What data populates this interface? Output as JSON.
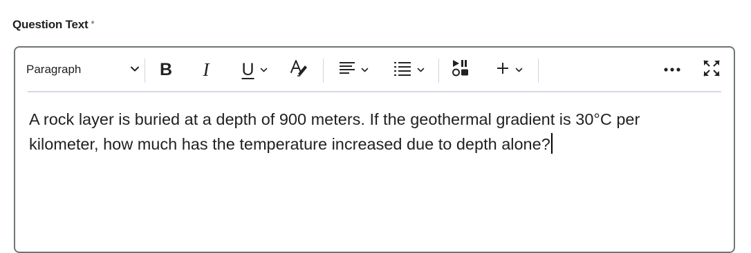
{
  "field": {
    "label": "Question Text",
    "required_marker": "*"
  },
  "toolbar": {
    "block_format": "Paragraph",
    "bold_label": "B",
    "italic_label": "I",
    "underline_label": "U",
    "icons": [
      "chevron-down-icon",
      "underline-icon",
      "text-color-icon",
      "align-icon",
      "list-icon",
      "insert-media-icon",
      "add-icon",
      "more-icon",
      "fullscreen-icon"
    ]
  },
  "editor": {
    "content": "A rock layer is buried at a depth of 900 meters. If the geothermal gradient is 30°C per kilometer, how much has the temperature increased due to depth alone?"
  },
  "colors": {
    "text": "#202122",
    "border": "#6e7477",
    "divider": "#d3d9e3"
  }
}
